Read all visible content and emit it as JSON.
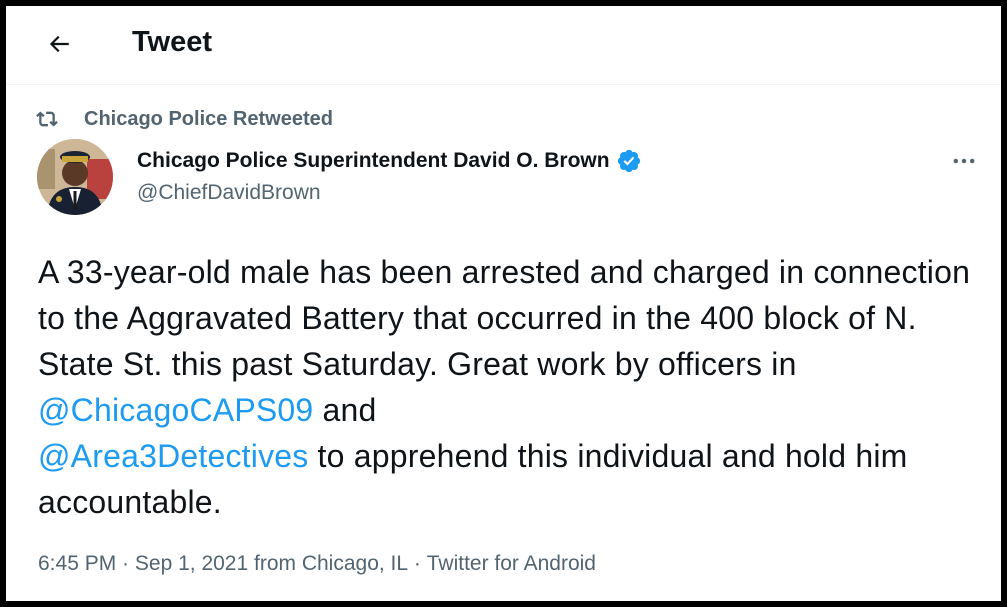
{
  "header": {
    "title": "Tweet",
    "back_icon": "arrow-left-icon"
  },
  "retweet": {
    "label": "Chicago Police Retweeted",
    "icon": "retweet-icon"
  },
  "author": {
    "name": "Chicago Police Superintendent David O. Brown",
    "handle": "@ChiefDavidBrown",
    "verified": true,
    "verified_color": "#1d9bf0"
  },
  "tweet": {
    "text_part1": "A 33-year-old male has been arrested and charged in connection to the Aggravated Battery that occurred in the 400 block of N. State St. this past Saturday. Great work by officers in ",
    "mention1": "@ChicagoCAPS09",
    "text_part2": " and ",
    "mention2": "@Area3Detectives",
    "text_part3": " to apprehend this individual and hold him accountable."
  },
  "meta": {
    "time": "6:45 PM",
    "sep1": " · ",
    "date": "Sep 1, 2021",
    "from": " from ",
    "location": "Chicago, IL",
    "sep2": " · ",
    "source": "Twitter for Android"
  },
  "colors": {
    "link": "#1d9bf0",
    "text": "#0f1419",
    "secondary": "#536471"
  }
}
